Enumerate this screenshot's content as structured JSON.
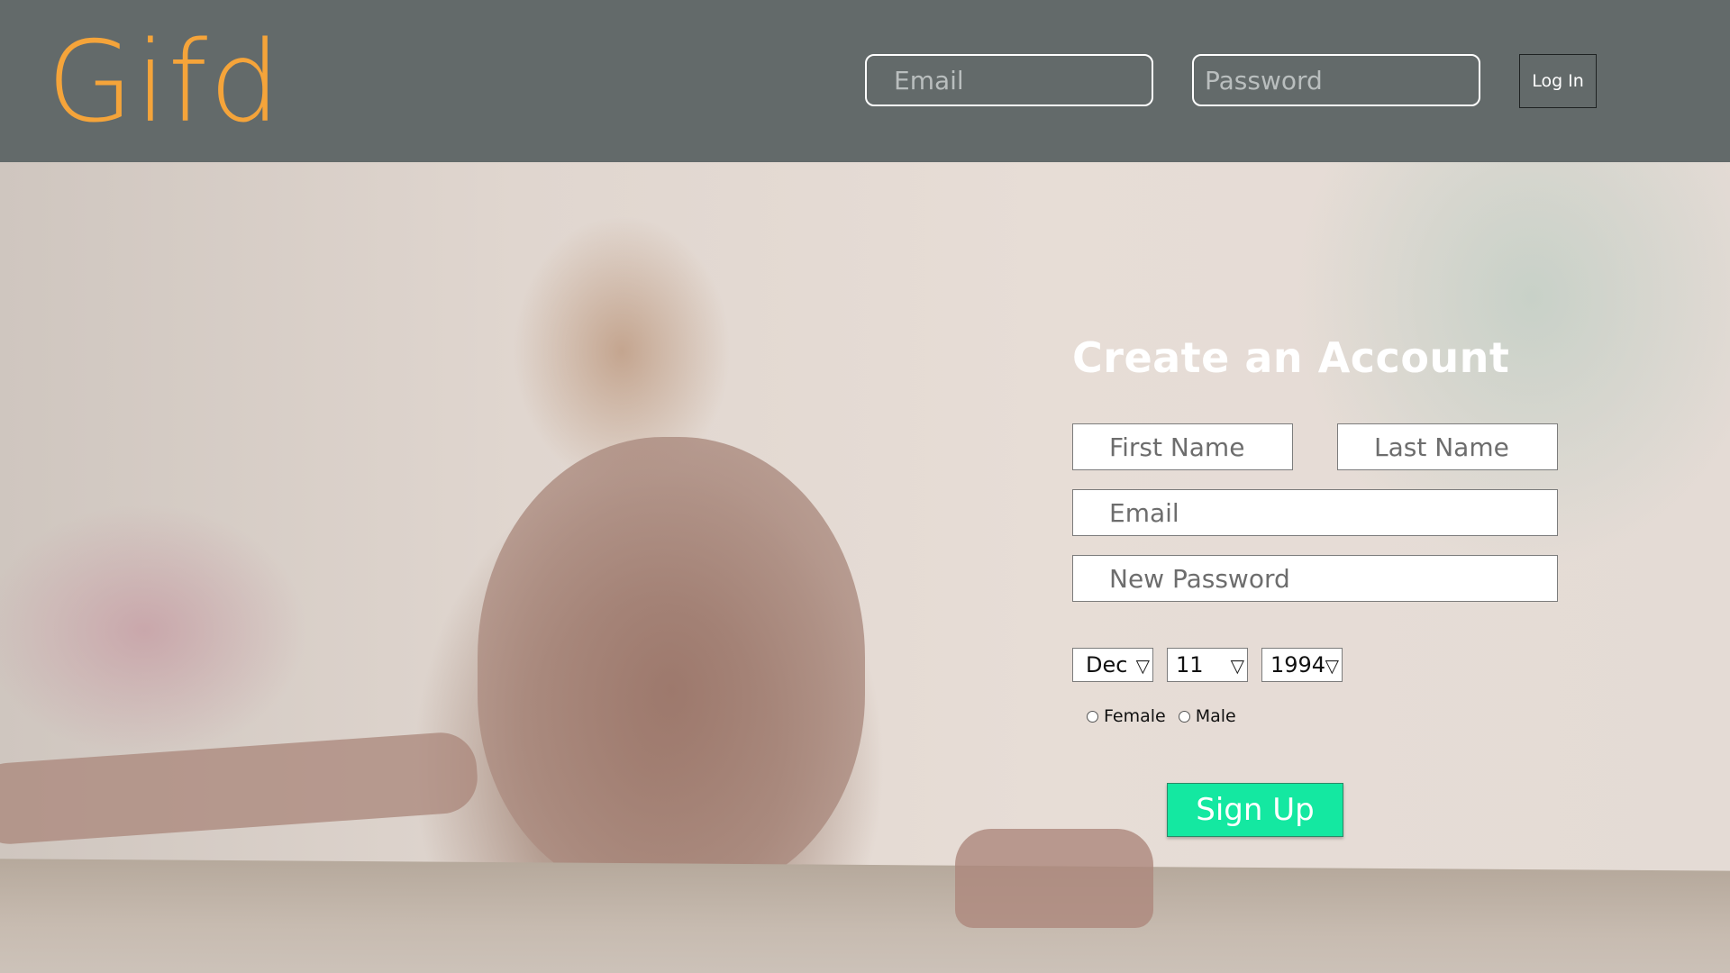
{
  "brand": {
    "name": "Gifd",
    "color": "#f5a43a"
  },
  "header": {
    "email_placeholder": "Email",
    "password_placeholder": "Password",
    "login_label": "Log In",
    "background_color": "#636a6a"
  },
  "signup": {
    "title": "Create an Account",
    "first_name_placeholder": "First Name",
    "last_name_placeholder": "Last Name",
    "email_placeholder": "Email",
    "password_placeholder": "New Password",
    "birthday": {
      "month": "Dec",
      "day": "11",
      "year": "1994"
    },
    "dropdown_arrow": "▽",
    "gender_options": [
      "Female",
      "Male"
    ],
    "submit_label": "Sign Up",
    "submit_color": "#14e8a1"
  },
  "hero": {
    "image": "blurred photo of smiling child leaning on a rusty rail"
  }
}
